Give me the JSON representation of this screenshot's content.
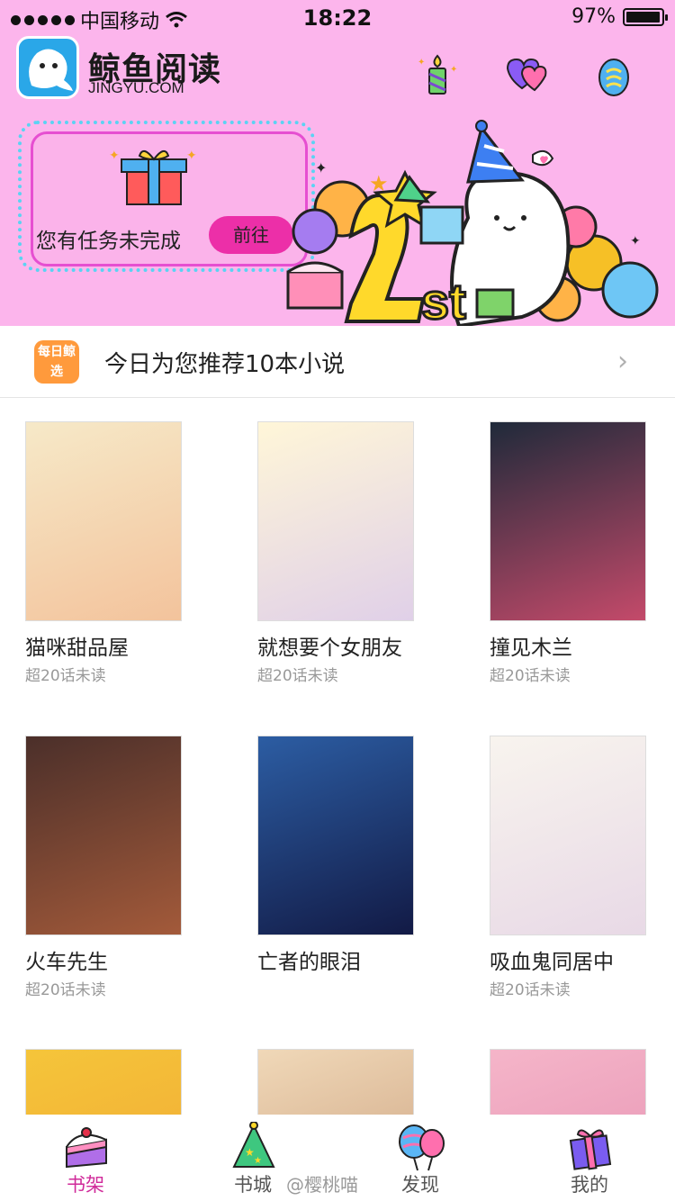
{
  "status": {
    "carrier": "中国移动",
    "time": "18:22",
    "battery": "97%",
    "battery_level": 0.97
  },
  "header": {
    "app_name": "鲸鱼阅读",
    "app_url": "JINGYU.COM",
    "task_text": "您有任务未完成",
    "task_button": "前往",
    "icons": [
      "candle-icon",
      "hearts-icon",
      "egg-icon"
    ]
  },
  "recommend": {
    "badge": "每日鲸选",
    "text": "今日为您推荐10本小说",
    "chevron": "›"
  },
  "books": [
    {
      "title": "猫咪甜品屋",
      "subtitle": "超20话未读",
      "colors": [
        "#f6e9c8",
        "#f3c39c"
      ]
    },
    {
      "title": "就想要个女朋友",
      "subtitle": "超20话未读",
      "colors": [
        "#fff6d8",
        "#e0d0e8"
      ]
    },
    {
      "title": "撞见木兰",
      "subtitle": "超20话未读",
      "colors": [
        "#1f2a3a",
        "#c44a6a"
      ]
    },
    {
      "title": "火车先生",
      "subtitle": "超20话未读",
      "colors": [
        "#4b2f2a",
        "#a35a3a"
      ]
    },
    {
      "title": "亡者的眼泪",
      "subtitle": "",
      "colors": [
        "#2c5da3",
        "#121a45"
      ]
    },
    {
      "title": "吸血鬼同居中",
      "subtitle": "超20话未读",
      "colors": [
        "#f8f4ee",
        "#e8d9e6"
      ]
    },
    {
      "title": "",
      "subtitle": "",
      "colors": [
        "#f5c53a",
        "#f0a534"
      ]
    },
    {
      "title": "",
      "subtitle": "",
      "colors": [
        "#f0d8b8",
        "#c89c7a"
      ]
    },
    {
      "title": "",
      "subtitle": "",
      "colors": [
        "#f5b5c9",
        "#e48fb0"
      ]
    }
  ],
  "tabs": [
    {
      "label": "书架",
      "active": true
    },
    {
      "label": "书城",
      "active": false
    },
    {
      "label": "发现",
      "active": false
    },
    {
      "label": "我的",
      "active": false
    }
  ],
  "watermark": "@樱桃喵",
  "colors": {
    "header_bg": "#fcb5ec",
    "accent": "#ec2fa8",
    "active_tab": "#d02a9a"
  }
}
